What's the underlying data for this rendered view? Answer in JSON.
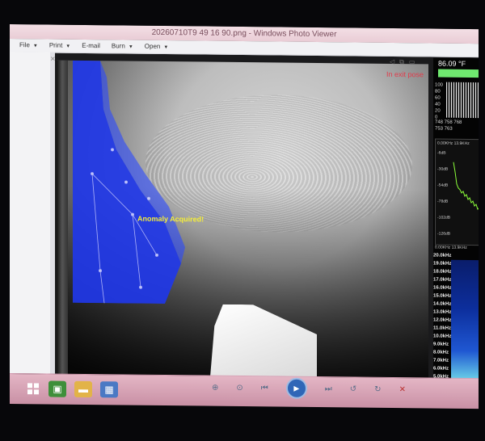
{
  "window": {
    "title": "20260710T9 49 16 90.png - Windows Photo Viewer"
  },
  "menu": {
    "items": [
      "File",
      "Print",
      "E-mail",
      "Burn",
      "Open"
    ]
  },
  "overlay": {
    "anomaly_label": "Anomaly Acquired!",
    "status_label": "In exit pose"
  },
  "panel": {
    "temperature": "86.09 °F",
    "hist_y": [
      "100",
      "80",
      "60",
      "40",
      "20",
      "0"
    ],
    "hist_x_top": "748 758 768",
    "hist_x_bottom": "753 763",
    "spec_top": "0.00KHz 13.9KHz",
    "spec_levels": [
      "-6dB",
      "-30dB",
      "-54dB",
      "-78dB",
      "-102dB",
      "-126dB"
    ],
    "spec_bottom": "0.00KHz 13.9KHz",
    "hz_list": [
      "20.0kHz",
      "19.0kHz",
      "18.0kHz",
      "17.0kHz",
      "16.0kHz",
      "15.0kHz",
      "14.0kHz",
      "13.0kHz",
      "12.0kHz",
      "11.0kHz",
      "10.0kHz",
      "9.0kHz",
      "8.0kHz",
      "7.0kHz",
      "6.0kHz",
      "5.0kHz",
      "4.0kHz",
      "3.0kHz",
      "2.0kHz",
      "1.0kHz"
    ]
  },
  "colors": {
    "accent_green": "#6fe86f",
    "blue_overlay": "#1f37e8",
    "warning_yellow": "#f5ee38",
    "status_red": "#e23a4a"
  },
  "icons": {
    "start": "windows-start-icon",
    "app": "app-icon",
    "folder": "folder-icon",
    "photo": "photo-viewer-icon"
  }
}
